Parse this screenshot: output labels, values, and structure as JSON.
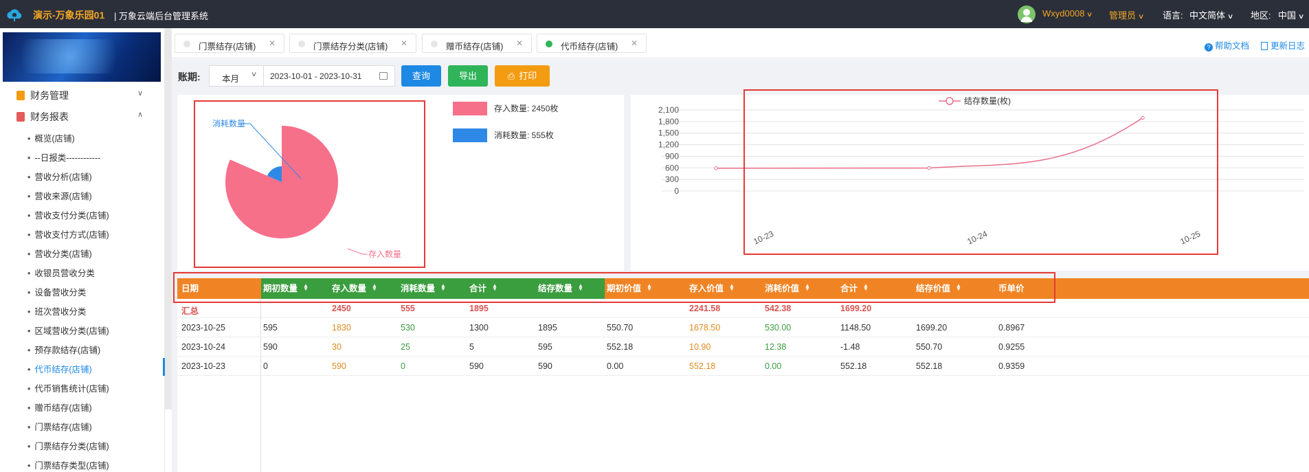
{
  "header": {
    "app_title": "演示-万象乐园01",
    "system_title": "| 万象云端后台管理系统",
    "user": "Wxyd0008",
    "role": "管理员",
    "language_label": "语言:",
    "language": "中文简体",
    "region_label": "地区:",
    "region": "中国"
  },
  "sidebar": {
    "groups": [
      {
        "label": "财务管理",
        "expanded": false
      },
      {
        "label": "财务报表",
        "expanded": true
      }
    ],
    "items": [
      "概览(店铺)",
      "--日报类------------",
      "营收分析(店铺)",
      "营收来源(店铺)",
      "营收支付分类(店铺)",
      "营收支付方式(店铺)",
      "营收分类(店铺)",
      "收银员营收分类",
      "设备营收分类",
      "班次营收分类",
      "区域营收分类(店铺)",
      "预存款结存(店铺)",
      "代币结存(店铺)",
      "代币销售统计(店铺)",
      "赠币结存(店铺)",
      "门票结存(店铺)",
      "门票结存分类(店铺)",
      "门票结存类型(店铺)"
    ],
    "active_index": 12
  },
  "tabs": [
    {
      "label": "门票结存(店铺)",
      "active": false
    },
    {
      "label": "门票结存分类(店铺)",
      "active": false
    },
    {
      "label": "赠币结存(店铺)",
      "active": false
    },
    {
      "label": "代币结存(店铺)",
      "active": true
    }
  ],
  "help": {
    "doc": "帮助文档",
    "log": "更新日志"
  },
  "filter": {
    "label": "账期:",
    "period": "本月",
    "date_range": "2023-10-01 - 2023-10-31",
    "query": "查询",
    "export": "导出",
    "print": "打印"
  },
  "pie": {
    "legend": [
      {
        "label": "存入数量: 2450枚",
        "color": "#f7708a"
      },
      {
        "label": "消耗数量: 555枚",
        "color": "#2e89e6"
      }
    ],
    "labels": {
      "deposit": "存入数量",
      "consume": "消耗数量"
    }
  },
  "chart_data": {
    "type": "line",
    "title": "",
    "legend": "结存数量(枚)",
    "x": [
      "10-23",
      "10-24",
      "10-25"
    ],
    "series": [
      {
        "name": "结存数量(枚)",
        "values": [
          590,
          595,
          1895
        ]
      }
    ],
    "yticks": [
      "2,100",
      "1,800",
      "1,500",
      "1,200",
      "900",
      "600",
      "300",
      "0"
    ],
    "ylim": [
      0,
      2100
    ],
    "grid": true,
    "color": "#e8708a"
  },
  "table": {
    "headers": [
      "日期",
      "期初数量",
      "存入数量",
      "消耗数量",
      "合计",
      "结存数量",
      "期初价值",
      "存入价值",
      "消耗价值",
      "合计",
      "结存价值",
      "币单价"
    ],
    "summary": [
      "汇总",
      "",
      "2450",
      "555",
      "1895",
      "",
      "",
      "2241.58",
      "542.38",
      "1699.20",
      "",
      ""
    ],
    "rows": [
      [
        "2023-10-25",
        "595",
        "1830",
        "530",
        "1300",
        "1895",
        "550.70",
        "1678.50",
        "530.00",
        "1148.50",
        "1699.20",
        "0.8967"
      ],
      [
        "2023-10-24",
        "590",
        "30",
        "25",
        "5",
        "595",
        "552.18",
        "10.90",
        "12.38",
        "-1.48",
        "550.70",
        "0.9255"
      ],
      [
        "2023-10-23",
        "0",
        "590",
        "0",
        "590",
        "590",
        "0.00",
        "552.18",
        "0.00",
        "552.18",
        "552.18",
        "0.9359"
      ]
    ]
  }
}
